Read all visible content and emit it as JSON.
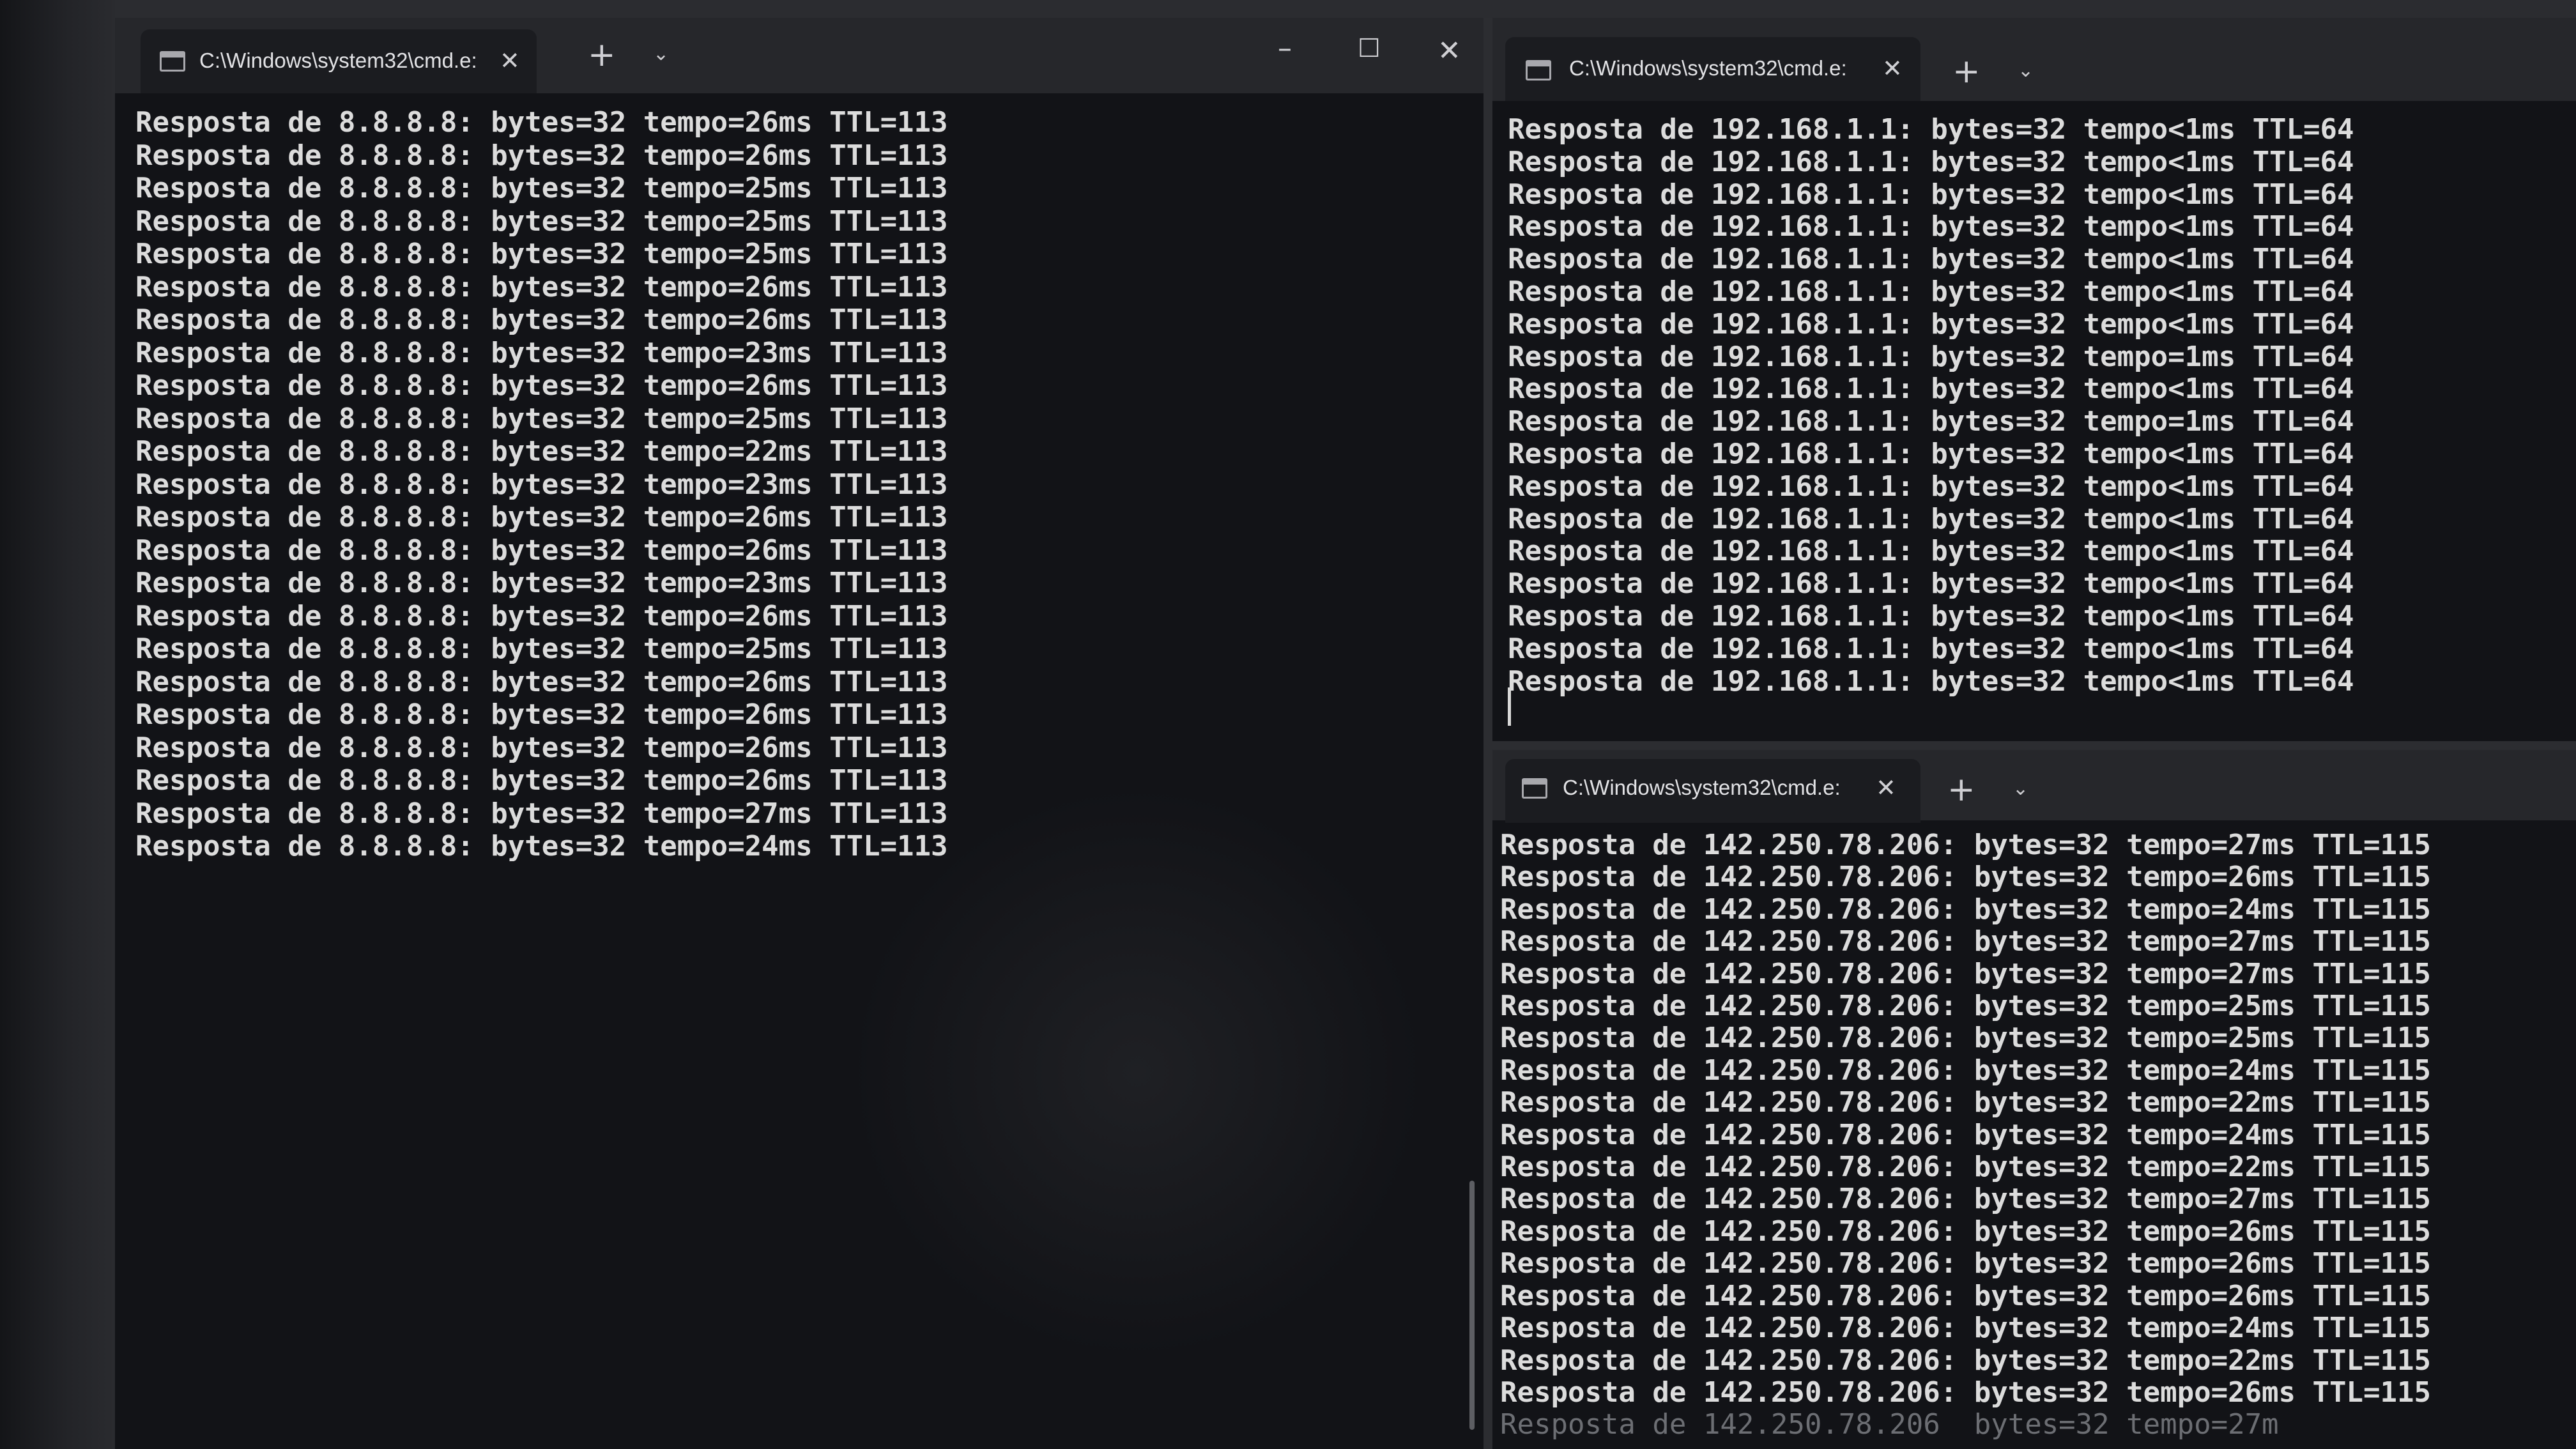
{
  "left_window": {
    "tab_title": "C:\\Windows\\system32\\cmd.e:",
    "tab_close": "✕",
    "new_tab": "+",
    "tab_menu": "⌄",
    "minimize": "–",
    "maximize": "☐",
    "close": "✕",
    "lines": [
      "Resposta de 8.8.8.8: bytes=32 tempo=26ms TTL=113",
      "Resposta de 8.8.8.8: bytes=32 tempo=26ms TTL=113",
      "Resposta de 8.8.8.8: bytes=32 tempo=25ms TTL=113",
      "Resposta de 8.8.8.8: bytes=32 tempo=25ms TTL=113",
      "Resposta de 8.8.8.8: bytes=32 tempo=25ms TTL=113",
      "Resposta de 8.8.8.8: bytes=32 tempo=26ms TTL=113",
      "Resposta de 8.8.8.8: bytes=32 tempo=26ms TTL=113",
      "Resposta de 8.8.8.8: bytes=32 tempo=23ms TTL=113",
      "Resposta de 8.8.8.8: bytes=32 tempo=26ms TTL=113",
      "Resposta de 8.8.8.8: bytes=32 tempo=25ms TTL=113",
      "Resposta de 8.8.8.8: bytes=32 tempo=22ms TTL=113",
      "Resposta de 8.8.8.8: bytes=32 tempo=23ms TTL=113",
      "Resposta de 8.8.8.8: bytes=32 tempo=26ms TTL=113",
      "Resposta de 8.8.8.8: bytes=32 tempo=26ms TTL=113",
      "Resposta de 8.8.8.8: bytes=32 tempo=23ms TTL=113",
      "Resposta de 8.8.8.8: bytes=32 tempo=26ms TTL=113",
      "Resposta de 8.8.8.8: bytes=32 tempo=25ms TTL=113",
      "Resposta de 8.8.8.8: bytes=32 tempo=26ms TTL=113",
      "Resposta de 8.8.8.8: bytes=32 tempo=26ms TTL=113",
      "Resposta de 8.8.8.8: bytes=32 tempo=26ms TTL=113",
      "Resposta de 8.8.8.8: bytes=32 tempo=26ms TTL=113",
      "Resposta de 8.8.8.8: bytes=32 tempo=27ms TTL=113",
      "Resposta de 8.8.8.8: bytes=32 tempo=24ms TTL=113"
    ]
  },
  "top_right_window": {
    "tab_title": "C:\\Windows\\system32\\cmd.e:",
    "tab_close": "✕",
    "new_tab": "+",
    "tab_menu": "⌄",
    "lines": [
      "Resposta de 192.168.1.1: bytes=32 tempo<1ms TTL=64",
      "Resposta de 192.168.1.1: bytes=32 tempo<1ms TTL=64",
      "Resposta de 192.168.1.1: bytes=32 tempo<1ms TTL=64",
      "Resposta de 192.168.1.1: bytes=32 tempo<1ms TTL=64",
      "Resposta de 192.168.1.1: bytes=32 tempo<1ms TTL=64",
      "Resposta de 192.168.1.1: bytes=32 tempo<1ms TTL=64",
      "Resposta de 192.168.1.1: bytes=32 tempo<1ms TTL=64",
      "Resposta de 192.168.1.1: bytes=32 tempo=1ms TTL=64",
      "Resposta de 192.168.1.1: bytes=32 tempo<1ms TTL=64",
      "Resposta de 192.168.1.1: bytes=32 tempo=1ms TTL=64",
      "Resposta de 192.168.1.1: bytes=32 tempo<1ms TTL=64",
      "Resposta de 192.168.1.1: bytes=32 tempo<1ms TTL=64",
      "Resposta de 192.168.1.1: bytes=32 tempo<1ms TTL=64",
      "Resposta de 192.168.1.1: bytes=32 tempo<1ms TTL=64",
      "Resposta de 192.168.1.1: bytes=32 tempo<1ms TTL=64",
      "Resposta de 192.168.1.1: bytes=32 tempo<1ms TTL=64",
      "Resposta de 192.168.1.1: bytes=32 tempo<1ms TTL=64",
      "Resposta de 192.168.1.1: bytes=32 tempo<1ms TTL=64"
    ]
  },
  "bottom_right_window": {
    "tab_title": "C:\\Windows\\system32\\cmd.e:",
    "tab_close": "✕",
    "new_tab": "+",
    "tab_menu": "⌄",
    "lines": [
      "Resposta de 142.250.78.206: bytes=32 tempo=27ms TTL=115",
      "Resposta de 142.250.78.206: bytes=32 tempo=26ms TTL=115",
      "Resposta de 142.250.78.206: bytes=32 tempo=24ms TTL=115",
      "Resposta de 142.250.78.206: bytes=32 tempo=27ms TTL=115",
      "Resposta de 142.250.78.206: bytes=32 tempo=27ms TTL=115",
      "Resposta de 142.250.78.206: bytes=32 tempo=25ms TTL=115",
      "Resposta de 142.250.78.206: bytes=32 tempo=25ms TTL=115",
      "Resposta de 142.250.78.206: bytes=32 tempo=24ms TTL=115",
      "Resposta de 142.250.78.206: bytes=32 tempo=22ms TTL=115",
      "Resposta de 142.250.78.206: bytes=32 tempo=24ms TTL=115",
      "Resposta de 142.250.78.206: bytes=32 tempo=22ms TTL=115",
      "Resposta de 142.250.78.206: bytes=32 tempo=27ms TTL=115",
      "Resposta de 142.250.78.206: bytes=32 tempo=26ms TTL=115",
      "Resposta de 142.250.78.206: bytes=32 tempo=26ms TTL=115",
      "Resposta de 142.250.78.206: bytes=32 tempo=26ms TTL=115",
      "Resposta de 142.250.78.206: bytes=32 tempo=24ms TTL=115",
      "Resposta de 142.250.78.206: bytes=32 tempo=22ms TTL=115",
      "Resposta de 142.250.78.206: bytes=32 tempo=26ms TTL=115"
    ],
    "partial_line": "Resposta de 142.250.78.206  bytes=32 tempo=27m"
  }
}
